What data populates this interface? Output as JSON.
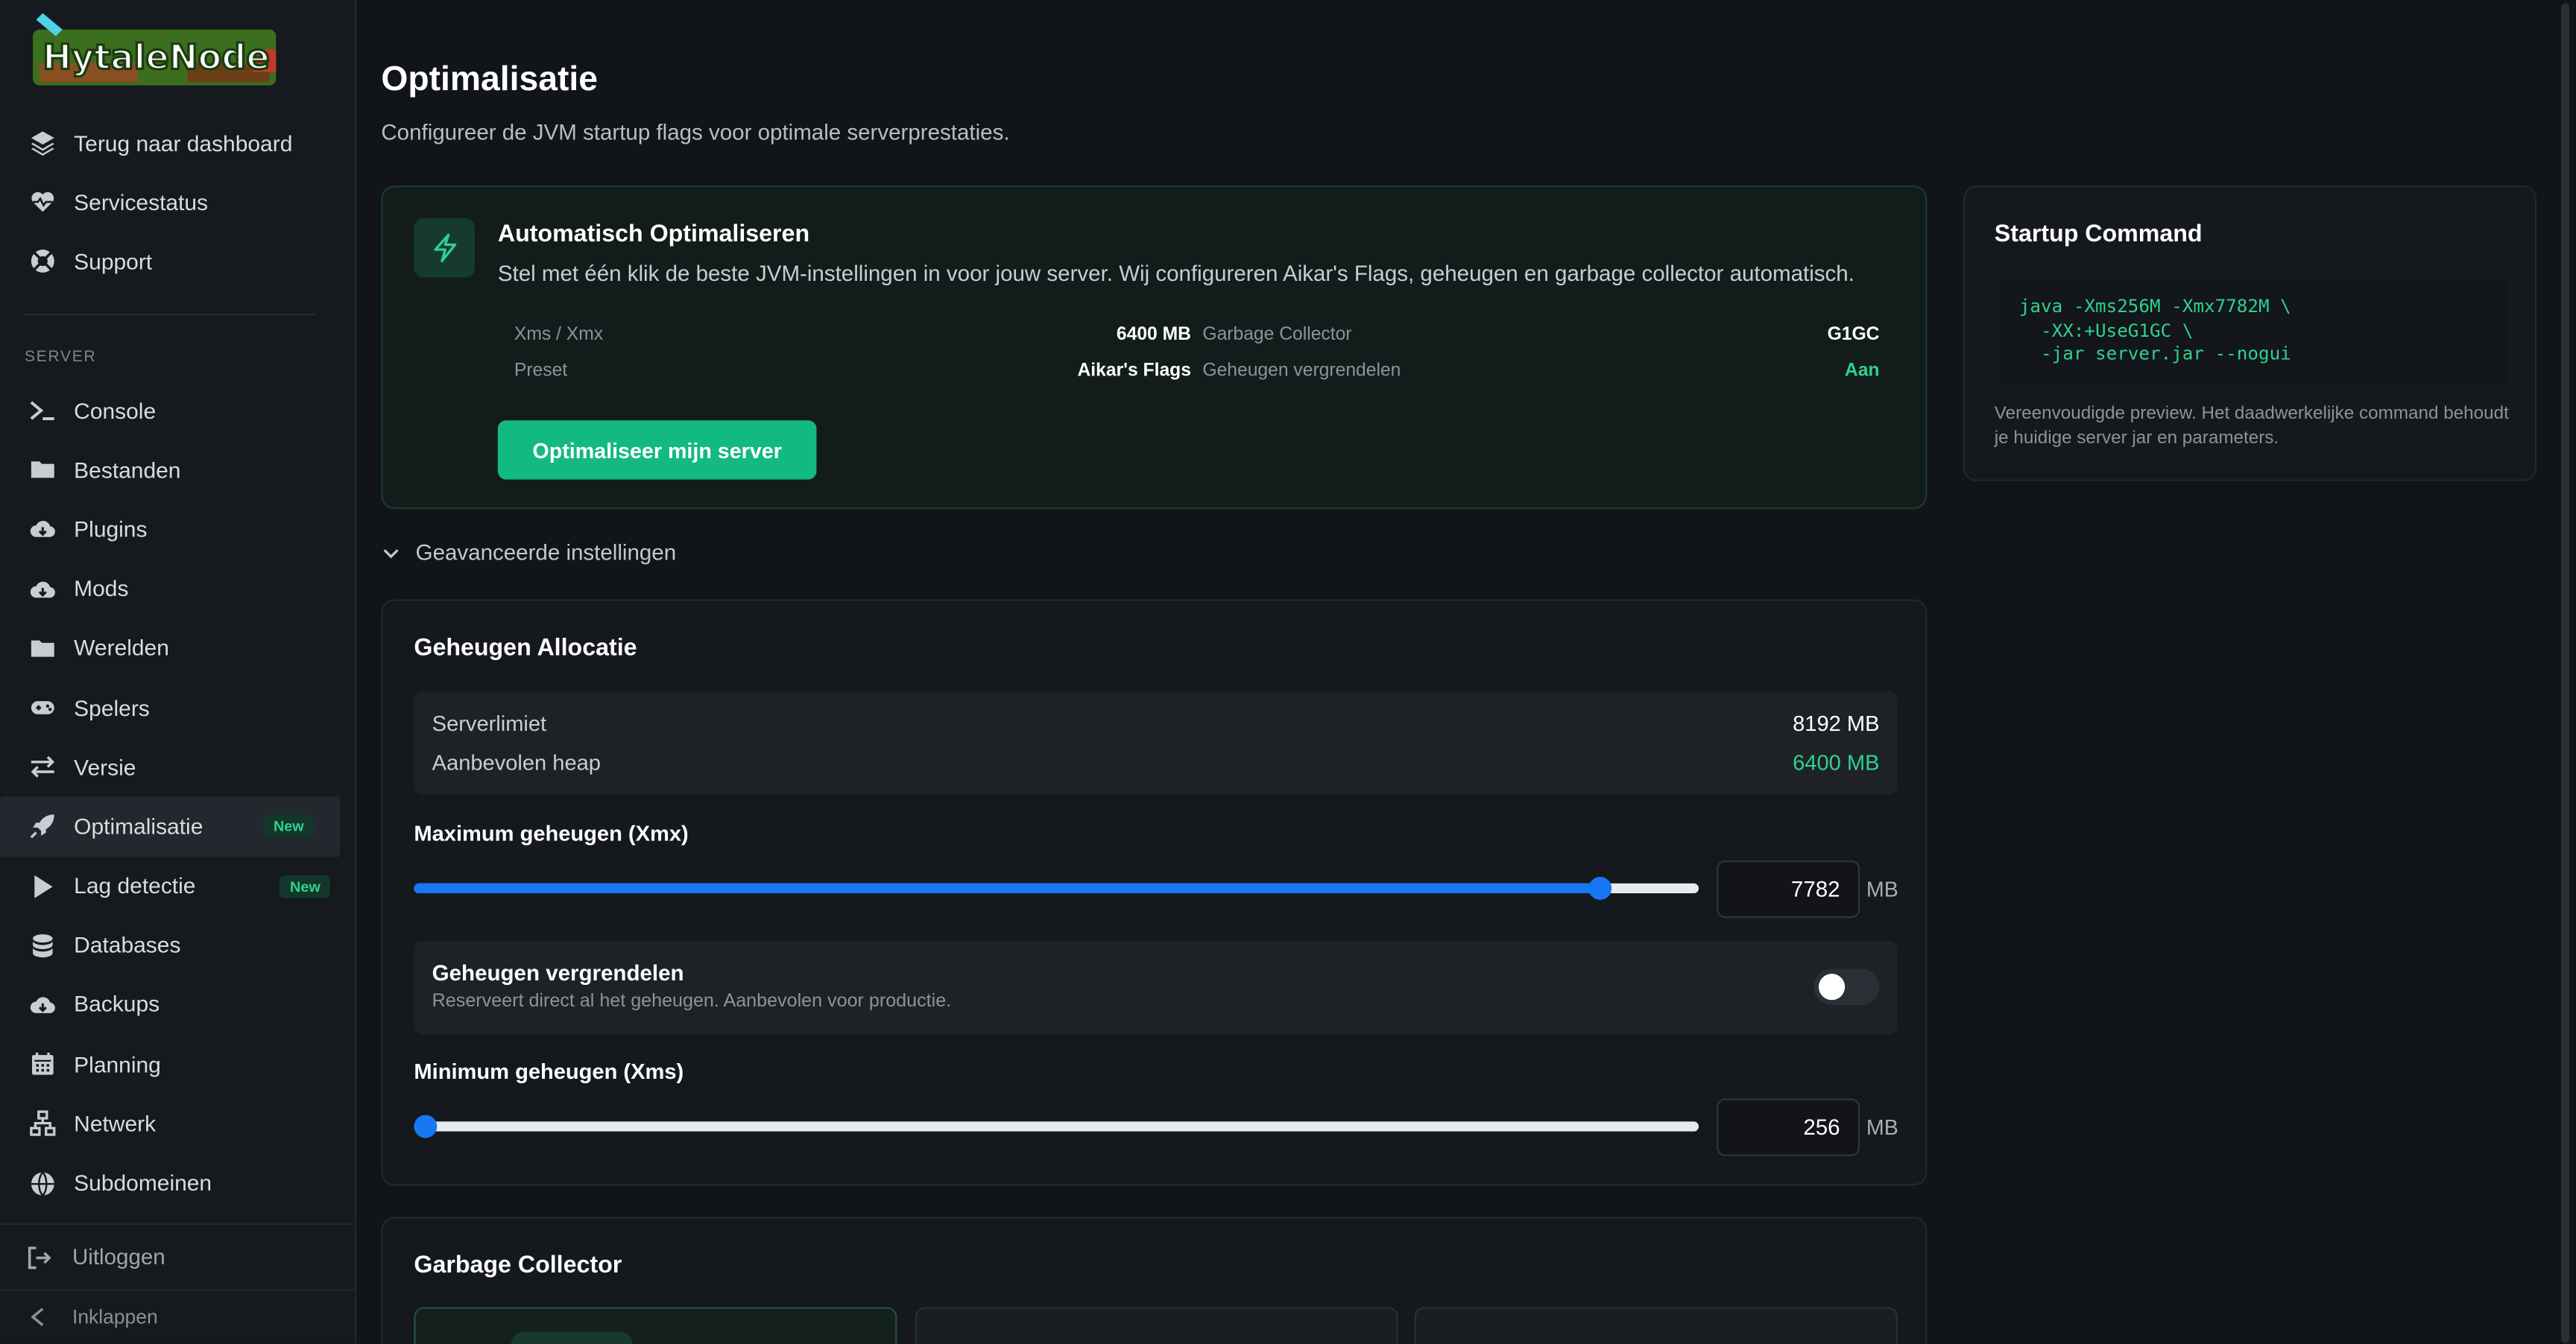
{
  "app": {
    "logo_text": "HytaleNode"
  },
  "sidebar": {
    "top_items": [
      {
        "label": "Terug naar dashboard",
        "icon": "layers-icon"
      },
      {
        "label": "Servicestatus",
        "icon": "heart-pulse-icon"
      },
      {
        "label": "Support",
        "icon": "lifebuoy-icon"
      }
    ],
    "section_label": "SERVER",
    "server_items": [
      {
        "label": "Console",
        "icon": "terminal-icon"
      },
      {
        "label": "Bestanden",
        "icon": "folder-icon"
      },
      {
        "label": "Plugins",
        "icon": "cloud-download-icon"
      },
      {
        "label": "Mods",
        "icon": "cloud-download-icon"
      },
      {
        "label": "Werelden",
        "icon": "folder-icon"
      },
      {
        "label": "Spelers",
        "icon": "gamepad-icon"
      },
      {
        "label": "Versie",
        "icon": "swap-arrows-icon"
      },
      {
        "label": "Optimalisatie",
        "icon": "rocket-icon",
        "badge": "New",
        "active": true
      },
      {
        "label": "Lag detectie",
        "icon": "play-icon",
        "badge": "New"
      },
      {
        "label": "Databases",
        "icon": "database-icon"
      },
      {
        "label": "Backups",
        "icon": "cloud-download-icon"
      },
      {
        "label": "Planning",
        "icon": "calendar-icon"
      },
      {
        "label": "Netwerk",
        "icon": "network-icon"
      },
      {
        "label": "Subdomeinen",
        "icon": "globe-icon"
      }
    ],
    "logout": "Uitloggen",
    "collapse": "Inklappen"
  },
  "page": {
    "title": "Optimalisatie",
    "subtitle": "Configureer de JVM startup flags voor optimale serverprestaties."
  },
  "auto": {
    "title": "Automatisch Optimaliseren",
    "description": "Stel met één klik de beste JVM-instellingen in voor jouw server. Wij configureren Aikar's Flags, geheugen en garbage collector automatisch.",
    "xms_xmx_label": "Xms / Xmx",
    "xms_xmx_value": "6400 MB",
    "gc_label": "Garbage Collector",
    "gc_value": "G1GC",
    "preset_label": "Preset",
    "preset_value": "Aikar's Flags",
    "lock_label": "Geheugen vergrendelen",
    "lock_value": "Aan",
    "button": "Optimaliseer mijn server",
    "accent": "#12b981"
  },
  "advanced": {
    "label": "Geavanceerde instellingen"
  },
  "memory": {
    "title": "Geheugen Allocatie",
    "server_limit_label": "Serverlimiet",
    "server_limit_value": "8192 MB",
    "recommended_label": "Aanbevolen heap",
    "recommended_value": "6400 MB",
    "max_label": "Maximum geheugen (Xmx)",
    "max_value": "7782",
    "max_fraction": 0.9306,
    "unit": "MB",
    "lock_title": "Geheugen vergrendelen",
    "lock_desc": "Reserveert direct al het geheugen. Aanbevolen voor productie.",
    "lock_on": false,
    "min_label": "Minimum geheugen (Xms)",
    "min_value": "256",
    "min_fraction": 0.0,
    "slider_color": "#1877f2"
  },
  "startup": {
    "title": "Startup Command",
    "code": "java -Xms256M -Xmx7782M \\\n  -XX:+UseG1GC \\\n  -jar server.jar --nogui",
    "note": "Vereenvoudigde preview. Het daadwerkelijke command behoudt je huidige server jar en parameters."
  },
  "gc": {
    "title": "Garbage Collector"
  }
}
